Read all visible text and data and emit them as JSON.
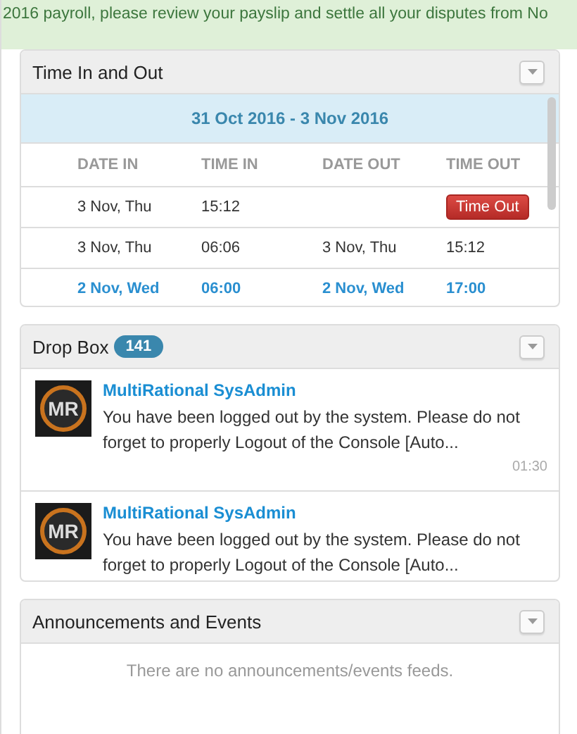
{
  "banner": {
    "text": "2016 payroll, please review your payslip and settle all your disputes from No"
  },
  "time_panel": {
    "title": "Time In and Out",
    "range": "31 Oct 2016 - 3 Nov 2016",
    "columns": [
      "DATE IN",
      "TIME IN",
      "DATE OUT",
      "TIME OUT"
    ],
    "rows": [
      {
        "date_in": "3 Nov, Thu",
        "time_in": "15:12",
        "date_out": "",
        "time_out": "Time Out",
        "kind": "button",
        "highlighted": false
      },
      {
        "date_in": "3 Nov, Thu",
        "time_in": "06:06",
        "date_out": "3 Nov, Thu",
        "time_out": "15:12",
        "kind": "text",
        "highlighted": false
      },
      {
        "date_in": "2 Nov, Wed",
        "time_in": "06:00",
        "date_out": "2 Nov, Wed",
        "time_out": "17:00",
        "kind": "text",
        "highlighted": true
      }
    ]
  },
  "dropbox": {
    "title": "Drop Box",
    "count": "141",
    "messages": [
      {
        "sender": "MultiRational SysAdmin",
        "logo_text": "MR",
        "body": "You have been logged out by the system. Please do not forget to properly Logout of the Console [Auto...",
        "time": "01:30"
      },
      {
        "sender": "MultiRational SysAdmin",
        "logo_text": "MR",
        "body": "You have been logged out by the system. Please do not forget to properly Logout of the Console [Auto..."
      }
    ]
  },
  "announcements": {
    "title": "Announcements and Events",
    "empty_text": "There are no announcements/events feeds."
  }
}
